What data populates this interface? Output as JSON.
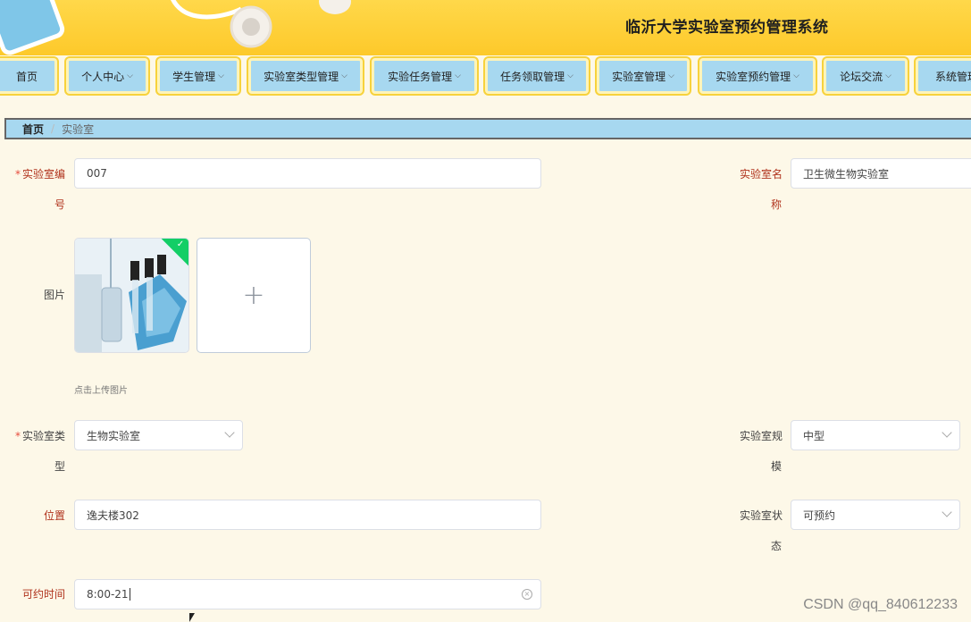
{
  "header": {
    "title": "临沂大学实验室预约管理系统"
  },
  "nav": {
    "items": [
      {
        "label": "首页",
        "dropdown": false
      },
      {
        "label": "个人中心",
        "dropdown": true
      },
      {
        "label": "学生管理",
        "dropdown": true
      },
      {
        "label": "实验室类型管理",
        "dropdown": true
      },
      {
        "label": "实验任务管理",
        "dropdown": true
      },
      {
        "label": "任务领取管理",
        "dropdown": true
      },
      {
        "label": "实验室管理",
        "dropdown": true
      },
      {
        "label": "实验室预约管理",
        "dropdown": true
      },
      {
        "label": "论坛交流",
        "dropdown": true
      },
      {
        "label": "系统管理",
        "dropdown": true
      }
    ],
    "chevron": "⌵"
  },
  "breadcrumb": {
    "home": "首页",
    "separator": "/",
    "current": "实验室"
  },
  "form": {
    "lab_no": {
      "label_line1": "实验室编",
      "label_line2": "号",
      "required_mark": "*",
      "value": "007"
    },
    "lab_name": {
      "label_line1": "实验室名",
      "label_line2": "称",
      "value": "卫生微生物实验室"
    },
    "image": {
      "label": "图片",
      "upload_hint": "点击上传图片",
      "add_symbol": "+",
      "checkmark": "✓"
    },
    "lab_type": {
      "label_line1": "实验室类",
      "label_line2": "型",
      "required_mark": "*",
      "value": "生物实验室"
    },
    "lab_scale": {
      "label_line1": "实验室规",
      "label_line2": "模",
      "value": "中型"
    },
    "location": {
      "label": "位置",
      "value": "逸夫楼302"
    },
    "lab_status": {
      "label_line1": "实验室状",
      "label_line2": "态",
      "value": "可预约"
    },
    "available_time": {
      "label": "可约时间",
      "value": "8:00-21",
      "clear_symbol": "×"
    }
  },
  "watermark": "CSDN @qq_840612233",
  "colors": {
    "header": "#fdc92a",
    "nav_bg": "#a7d8f0",
    "page_bg": "#fdf8e8",
    "required_label": "#b0321c"
  }
}
